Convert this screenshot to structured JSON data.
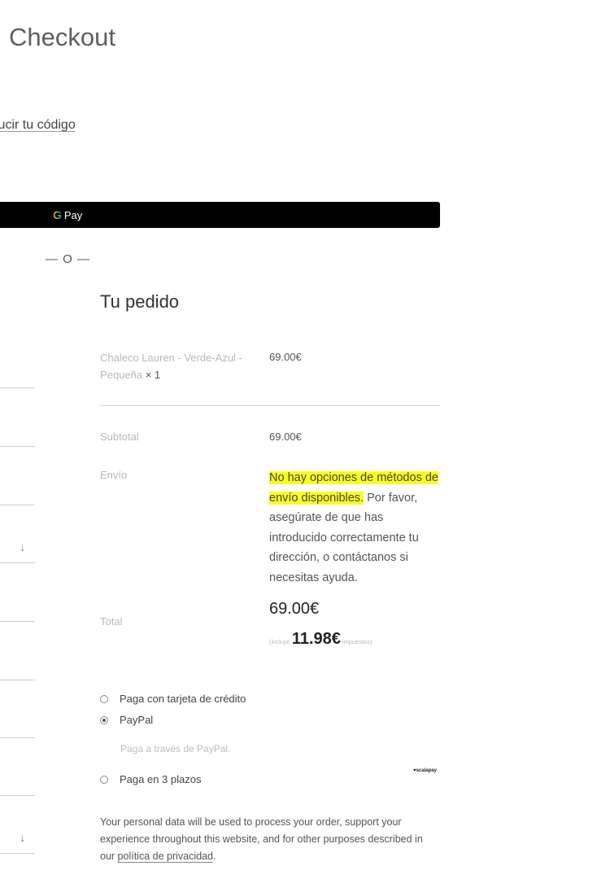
{
  "page": {
    "title": "Checkout"
  },
  "coupon": {
    "link_text": "lucir tu código"
  },
  "express": {
    "gpay_g": "G",
    "gpay_label": "Pay",
    "or_separator": "— O —"
  },
  "order": {
    "title": "Tu pedido",
    "product": {
      "name": "Chaleco Lauren - Verde-Azul - Pequeña",
      "qty": "× 1",
      "price": "69.00€"
    },
    "subtotal": {
      "label": "Subtotal",
      "value": "69.00€"
    },
    "shipping": {
      "label": "Envío",
      "message_highlighted": "No hay opciones de métodos de envío disponibles.",
      "message_rest": " Por favor, asegúrate de que has introducido correctamente tu dirección, o contáctanos si necesitas ayuda."
    },
    "total": {
      "label": "Total",
      "value": "69.00€",
      "tax_prefix": "(incluye",
      "tax_value": "11.98€",
      "tax_suffix": "impuestos)"
    }
  },
  "payment": {
    "methods": [
      {
        "label": "Paga con tarjeta de crédito",
        "selected": false
      },
      {
        "label": "PayPal",
        "selected": true,
        "description": "Paga a través de PayPal."
      },
      {
        "label": "Paga en 3 plazos",
        "selected": false,
        "badge": "♥scalapay"
      }
    ]
  },
  "privacy": {
    "text": "Your personal data will be used to process your order, support your experience throughout this website, and for other purposes described in our ",
    "link_text": "política de privacidad",
    "end": "."
  },
  "form": {
    "select_arrow_icon": "arrow-down-icon"
  }
}
